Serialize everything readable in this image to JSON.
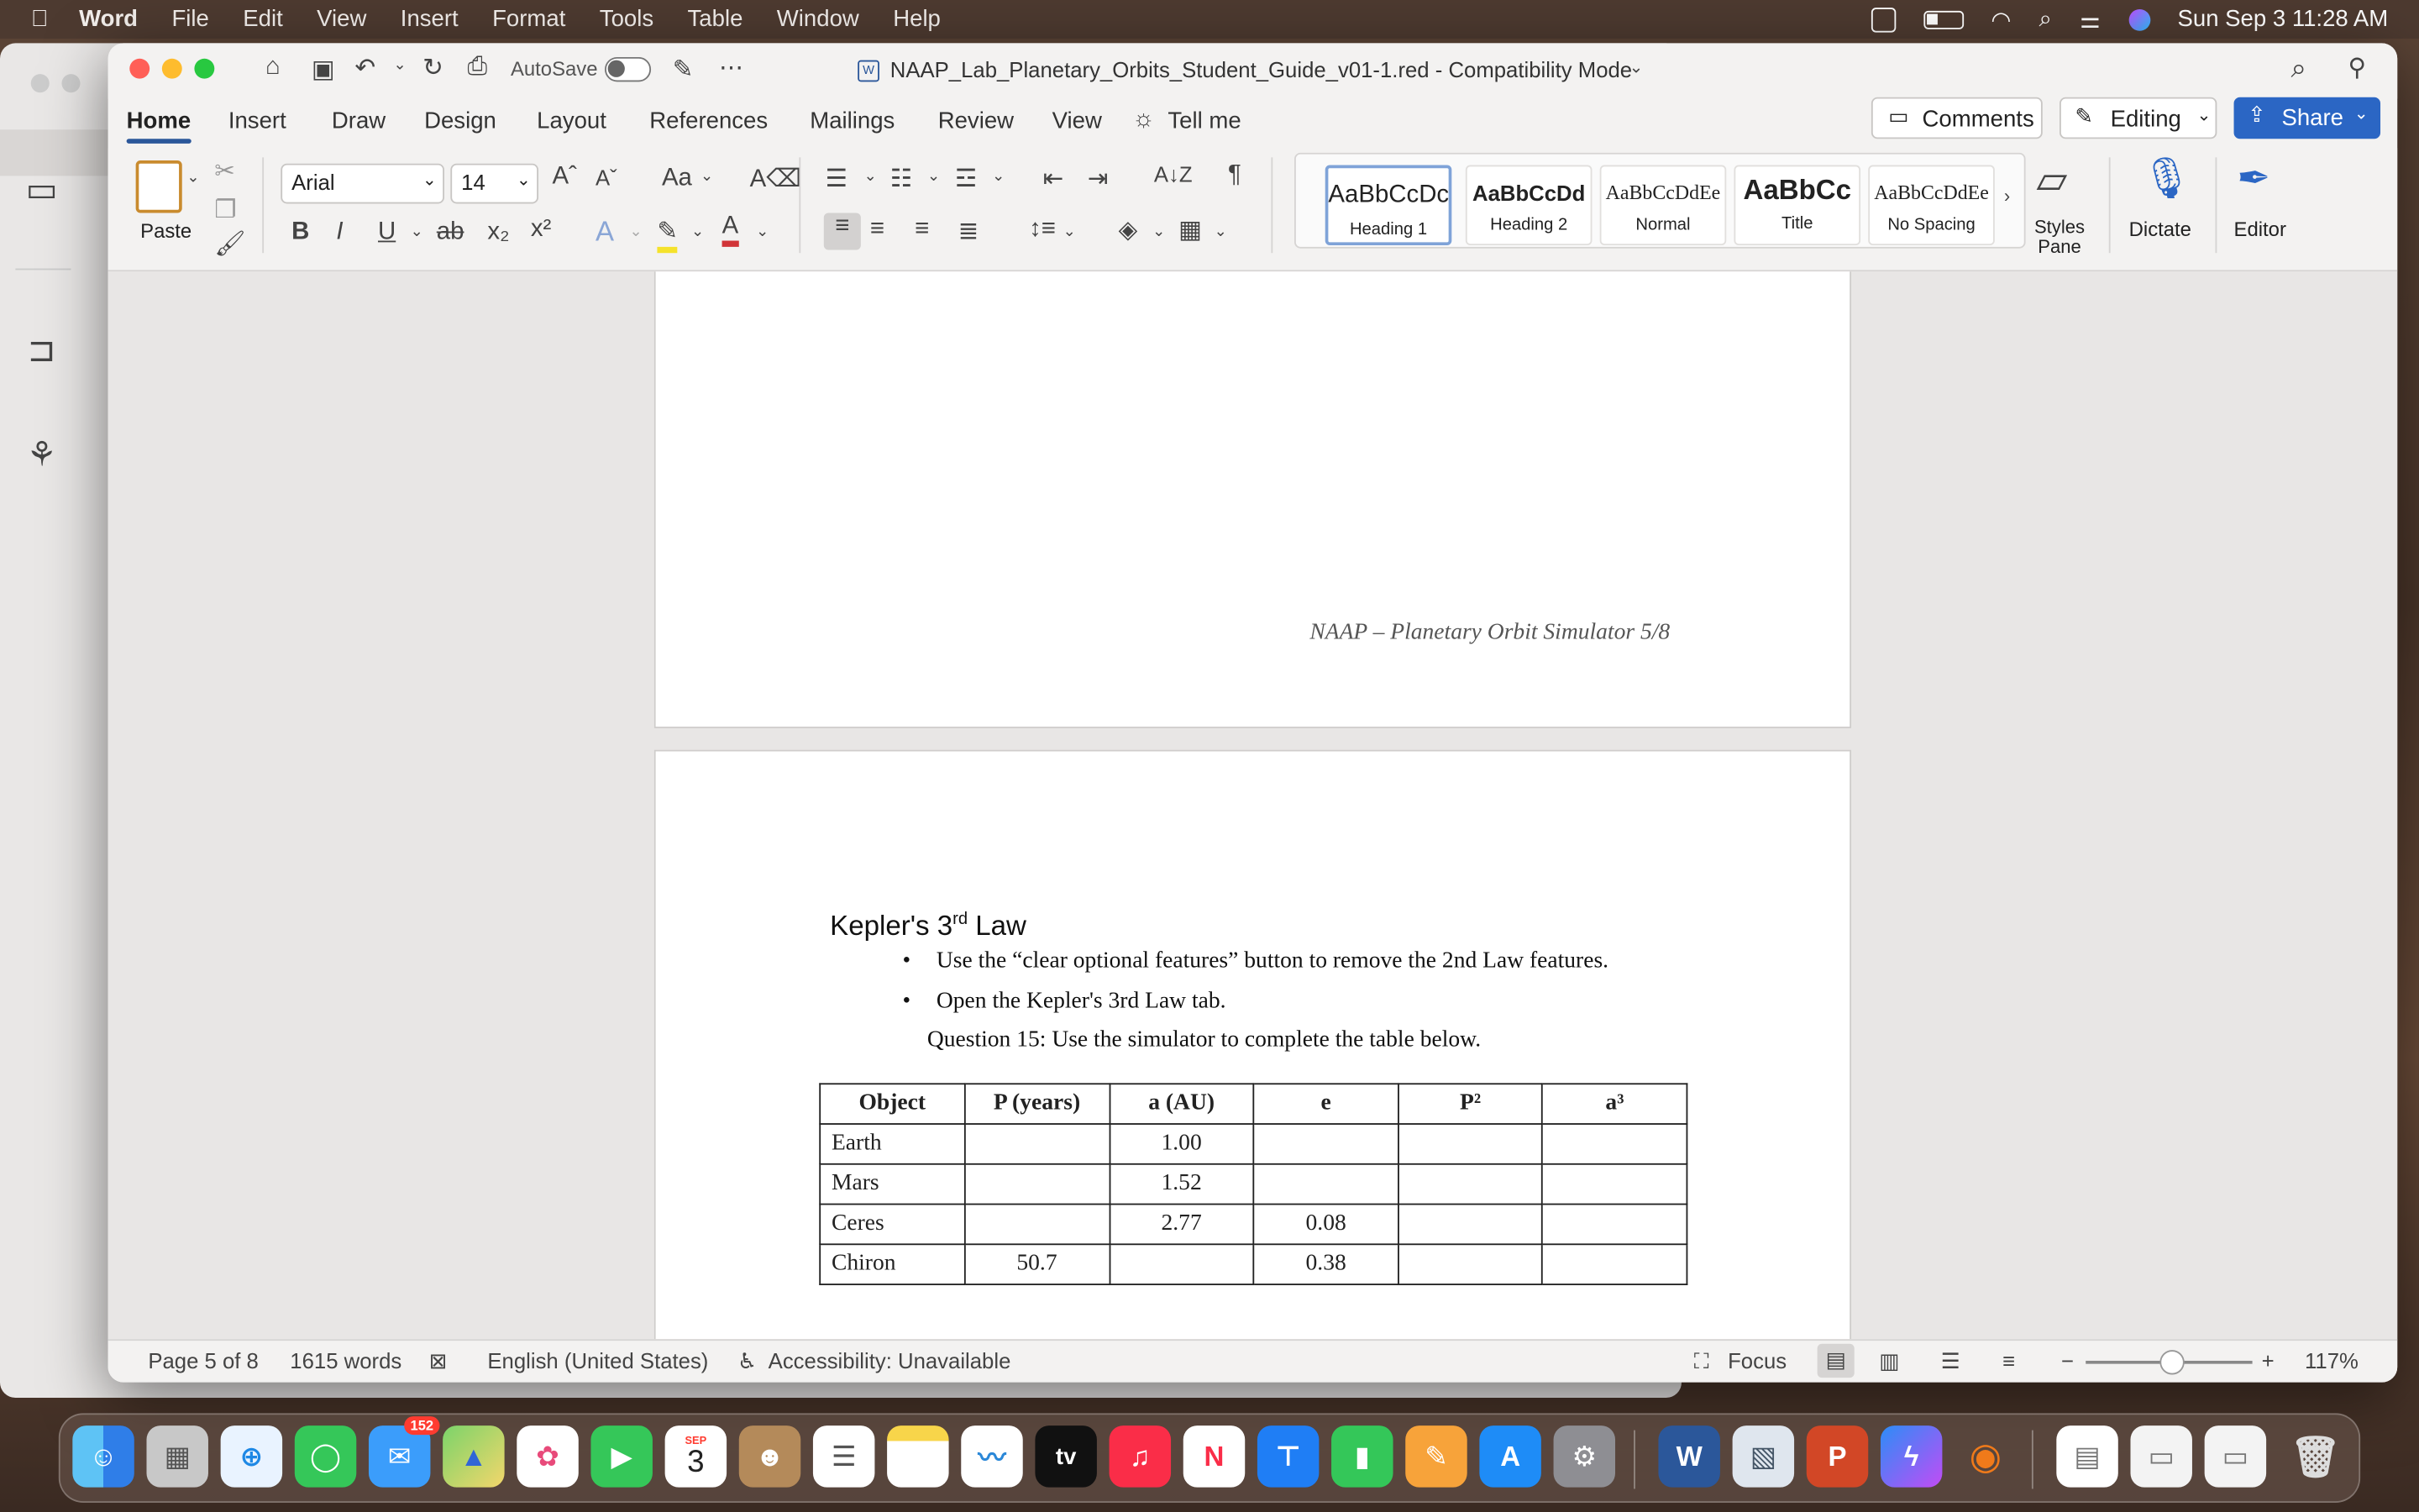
{
  "menubar": {
    "apple": "",
    "app": "Word",
    "items": [
      "File",
      "Edit",
      "View",
      "Insert",
      "Format",
      "Tools",
      "Table",
      "Window",
      "Help"
    ],
    "datetime": "Sun Sep 3  11:28 AM"
  },
  "window": {
    "title": "NAAP_Lab_Planetary_Orbits_Student_Guide_v01-1.red  -  Compatibility Mode",
    "autosave_label": "AutoSave"
  },
  "tabs": [
    "Home",
    "Insert",
    "Draw",
    "Design",
    "Layout",
    "References",
    "Mailings",
    "Review",
    "View",
    "Tell me"
  ],
  "top_right": {
    "comments": "Comments",
    "editing": "Editing",
    "share": "Share"
  },
  "ribbon": {
    "paste": "Paste",
    "font_name": "Arial",
    "font_size": "14",
    "styles": [
      {
        "preview": "AaBbCcDc",
        "name": "Heading 1"
      },
      {
        "preview": "AaBbCcDd",
        "name": "Heading 2"
      },
      {
        "preview": "AaBbCcDdEe",
        "name": "Normal"
      },
      {
        "preview": "AaBbCc",
        "name": "Title"
      },
      {
        "preview": "AaBbCcDdEe",
        "name": "No Spacing"
      }
    ],
    "styles_pane": "Styles Pane",
    "dictate": "Dictate",
    "editor": "Editor"
  },
  "document": {
    "footer": "NAAP – Planetary Orbit Simulator 5/8",
    "heading": "Kepler's 3",
    "heading_sup": "rd",
    "heading_tail": " Law",
    "bullets": [
      "Use the “clear optional features” button to remove the 2nd Law features.",
      "Open the Kepler's 3rd Law tab."
    ],
    "question": "Question 15:  Use the simulator to complete the table below.",
    "table": {
      "headers": [
        "Object",
        "P (years)",
        "a (AU)",
        "e",
        "P²",
        "a³"
      ],
      "rows": [
        [
          "Earth",
          "",
          "1.00",
          "",
          "",
          ""
        ],
        [
          "Mars",
          "",
          "1.52",
          "",
          "",
          ""
        ],
        [
          "Ceres",
          "",
          "2.77",
          "0.08",
          "",
          ""
        ],
        [
          "Chiron",
          "50.7",
          "",
          "0.38",
          "",
          ""
        ]
      ]
    }
  },
  "status": {
    "page": "Page 5 of 8",
    "words": "1615 words",
    "language": "English (United States)",
    "accessibility": "Accessibility: Unavailable",
    "focus": "Focus",
    "zoom": "117%"
  },
  "dock": {
    "mail_badge": "152",
    "calendar_month": "SEP",
    "calendar_day": "3",
    "tv": "tv"
  }
}
